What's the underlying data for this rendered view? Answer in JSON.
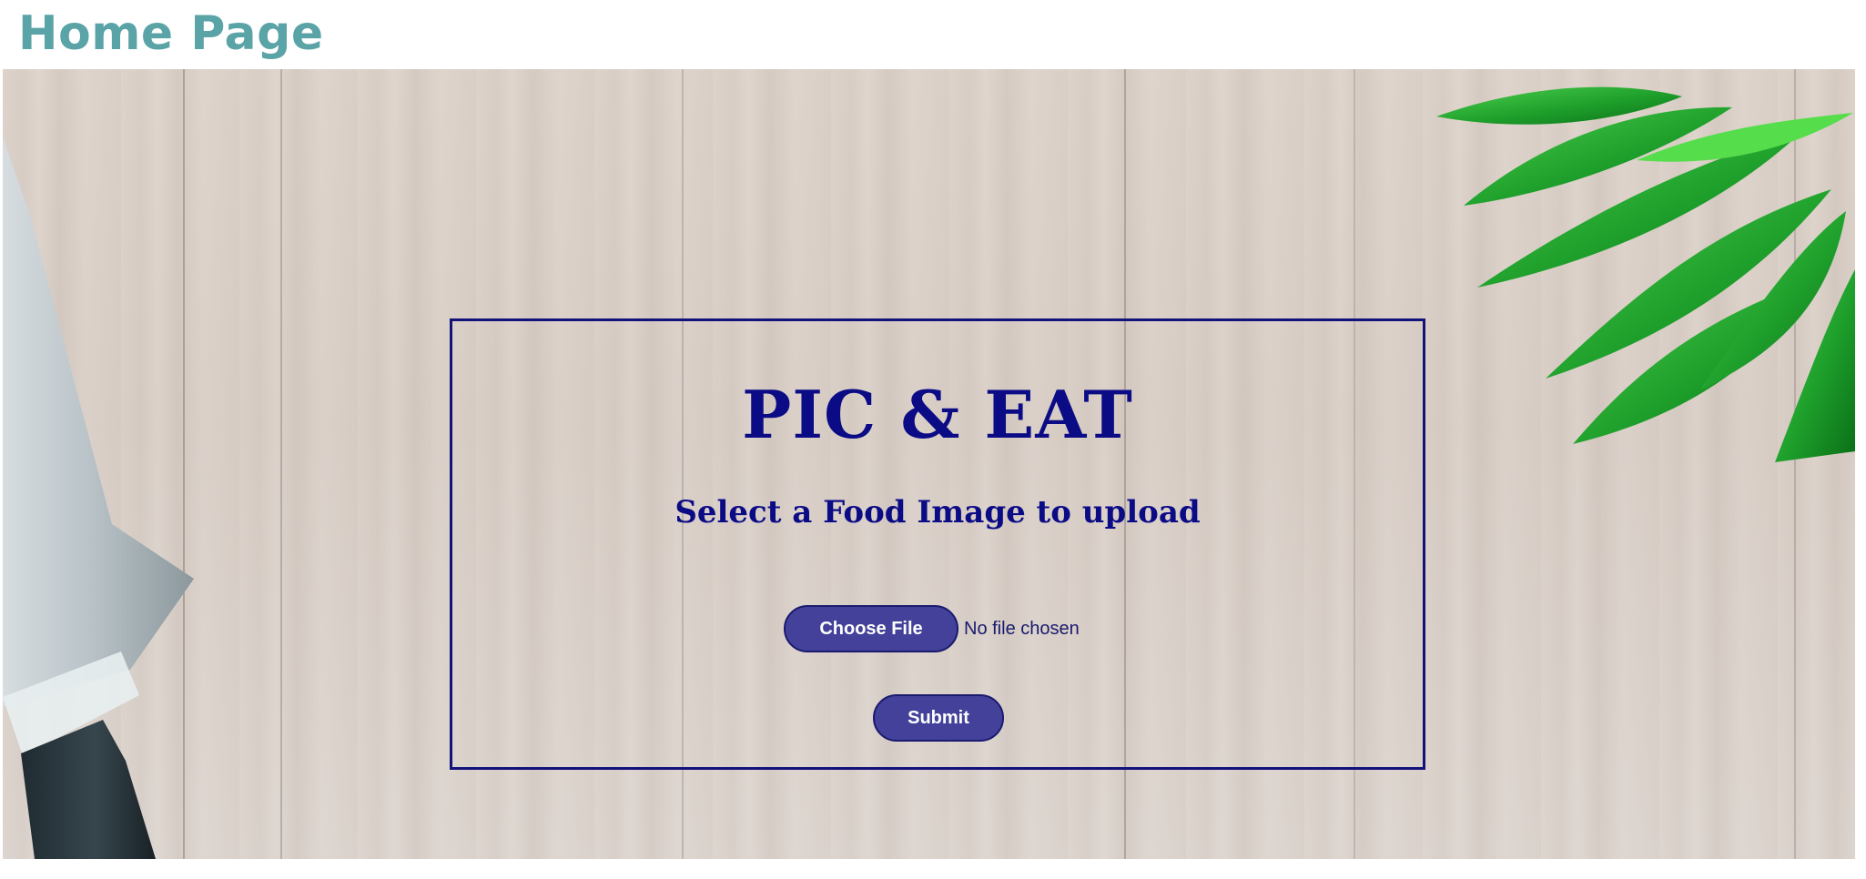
{
  "header": {
    "title": "Home Page"
  },
  "upload": {
    "title": "PIC & EAT",
    "subtitle": "Select a Food Image to upload",
    "choose_file_label": "Choose File",
    "file_status": "No file chosen",
    "submit_label": "Submit"
  },
  "colors": {
    "header_text": "#5aa3a6",
    "panel_accent": "#0b0b86",
    "button_fill": "#43419a"
  },
  "decorations": {
    "left_object": "knife-illustration",
    "right_object": "green-leaves-illustration"
  }
}
